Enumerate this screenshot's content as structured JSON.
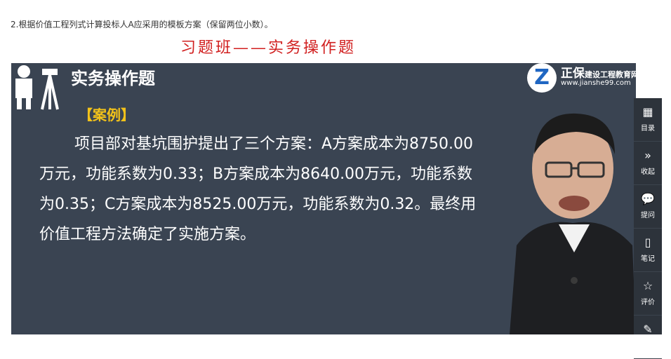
{
  "question": "2.根据价值工程列式计算投标人A应采用的模板方案（保留两位小数）。",
  "banner": "习题班——实务操作题",
  "video": {
    "slide_title": "实务操作题",
    "logo": {
      "mark": "Z",
      "brand": "正保",
      "name_suffix": "建设工程教育网",
      "url": "www.jianshe99.com"
    },
    "case_label": "【案例】",
    "case_lines": [
      "项目部对基坑围护提出了三个方案：A方案成本为8750.00",
      "万元，功能系数为0.33；B方案成本为8640.00万元，功能系数",
      "为0.35；C方案成本为8525.00万元，功能系数为0.32。最终用",
      "价值工程方法确定了实施方案。"
    ]
  },
  "sidebar": {
    "items": [
      {
        "label": "目录",
        "icon": "grid-icon"
      },
      {
        "label": "收起",
        "icon": "collapse-icon"
      },
      {
        "label": "提问",
        "icon": "chat-icon"
      },
      {
        "label": "笔记",
        "icon": "note-icon"
      },
      {
        "label": "评价",
        "icon": "star-icon"
      },
      {
        "label": "",
        "icon": "edit-icon"
      }
    ]
  },
  "colors": {
    "slide_bg": "#3a4452",
    "banner_red": "#d11f1f",
    "case_yellow": "#f2c21a"
  }
}
